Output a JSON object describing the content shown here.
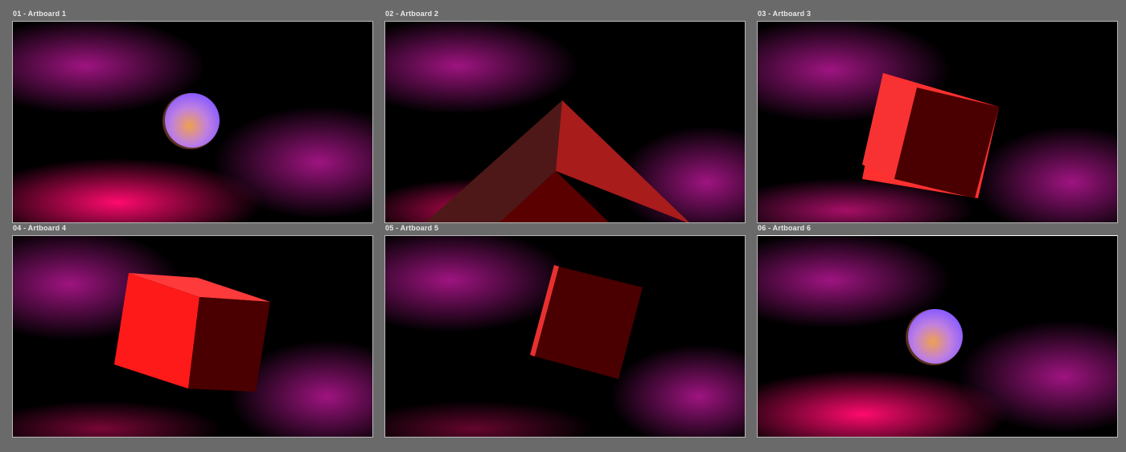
{
  "artboards": [
    {
      "label": "01 - Artboard 1",
      "object": "sphere"
    },
    {
      "label": "02 - Artboard 2",
      "object": "pyramid"
    },
    {
      "label": "03 - Artboard 3",
      "object": "cube"
    },
    {
      "label": "04 - Artboard 4",
      "object": "cube"
    },
    {
      "label": "05 - Artboard 5",
      "object": "cube"
    },
    {
      "label": "06 - Artboard 6",
      "object": "sphere"
    }
  ],
  "colors": {
    "workspace": "#6a6a6a",
    "artboard_background": "#000000",
    "glow_magenta": "#b0168f",
    "glow_pink": "#ff0a6e",
    "object_red": "#f02222",
    "object_dark_red": "#4a0000",
    "sphere_violet": "#9a6cff",
    "sphere_orange": "#f0a050"
  }
}
